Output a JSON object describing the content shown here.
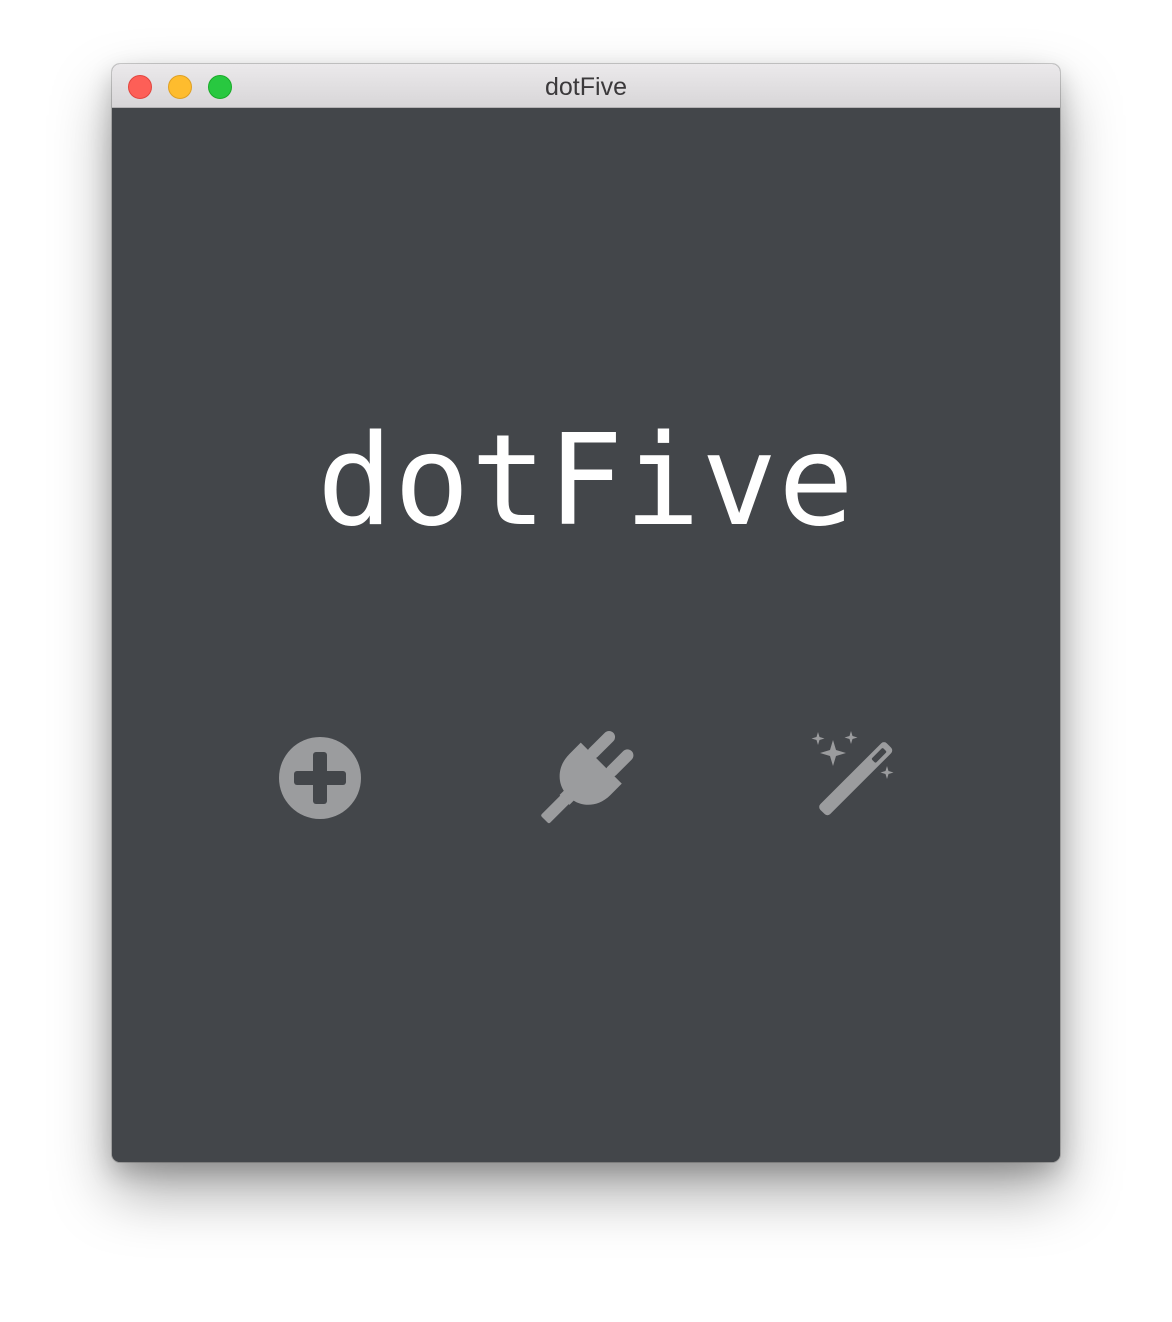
{
  "window": {
    "title": "dotFive"
  },
  "main": {
    "app_title": "dotFive",
    "actions": [
      {
        "name": "add",
        "icon": "plus-circle-icon"
      },
      {
        "name": "connect",
        "icon": "plug-icon"
      },
      {
        "name": "magic",
        "icon": "magic-wand-icon"
      }
    ]
  },
  "colors": {
    "background": "#43464a",
    "icon": "#9b9c9e",
    "title_text": "#ffffff"
  }
}
